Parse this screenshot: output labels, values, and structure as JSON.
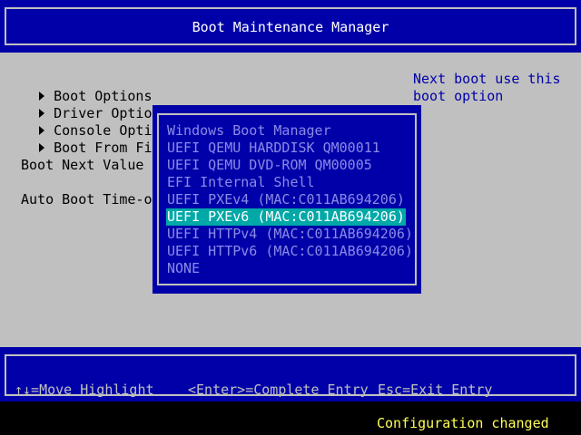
{
  "title": "Boot Maintenance Manager",
  "menu": {
    "items": [
      {
        "label": "Boot Options"
      },
      {
        "label": "Driver Options"
      },
      {
        "label": "Console Options"
      },
      {
        "label": "Boot From File"
      }
    ],
    "boot_next_label": "Boot Next Value",
    "auto_boot_label": "Auto Boot Time-out"
  },
  "help": {
    "line1": "Next boot use this",
    "line2": "boot option"
  },
  "popup": {
    "options": [
      {
        "label": "Windows Boot Manager",
        "selected": false
      },
      {
        "label": "UEFI QEMU HARDDISK QM00011",
        "selected": false
      },
      {
        "label": "UEFI QEMU DVD-ROM QM00005",
        "selected": false
      },
      {
        "label": "EFI Internal Shell",
        "selected": false
      },
      {
        "label": "UEFI PXEv4 (MAC:C011AB694206)",
        "selected": false
      },
      {
        "label": "UEFI PXEv6 (MAC:C011AB694206)",
        "selected": true
      },
      {
        "label": "UEFI HTTPv4 (MAC:C011AB694206)",
        "selected": false
      },
      {
        "label": "UEFI HTTPv6 (MAC:C011AB694206)",
        "selected": false
      },
      {
        "label": "NONE",
        "selected": false
      }
    ]
  },
  "footer": {
    "move_hint": "↑↓=Move Highlight",
    "enter_hint": "<Enter>=Complete Entry",
    "esc_hint": "Esc=Exit Entry",
    "status": "Configuration changed"
  },
  "colors": {
    "title_background": "#0000a8",
    "main_background": "#c0c0c0",
    "help_text": "#0000a8",
    "popup_background": "#0000a8",
    "popup_text": "#8a8ae8",
    "selected_background": "#00a8a8",
    "selected_text": "#ffffff",
    "status_text": "#ffff55"
  },
  "icons": {
    "menu_item_marker": "triangle-right-icon"
  }
}
